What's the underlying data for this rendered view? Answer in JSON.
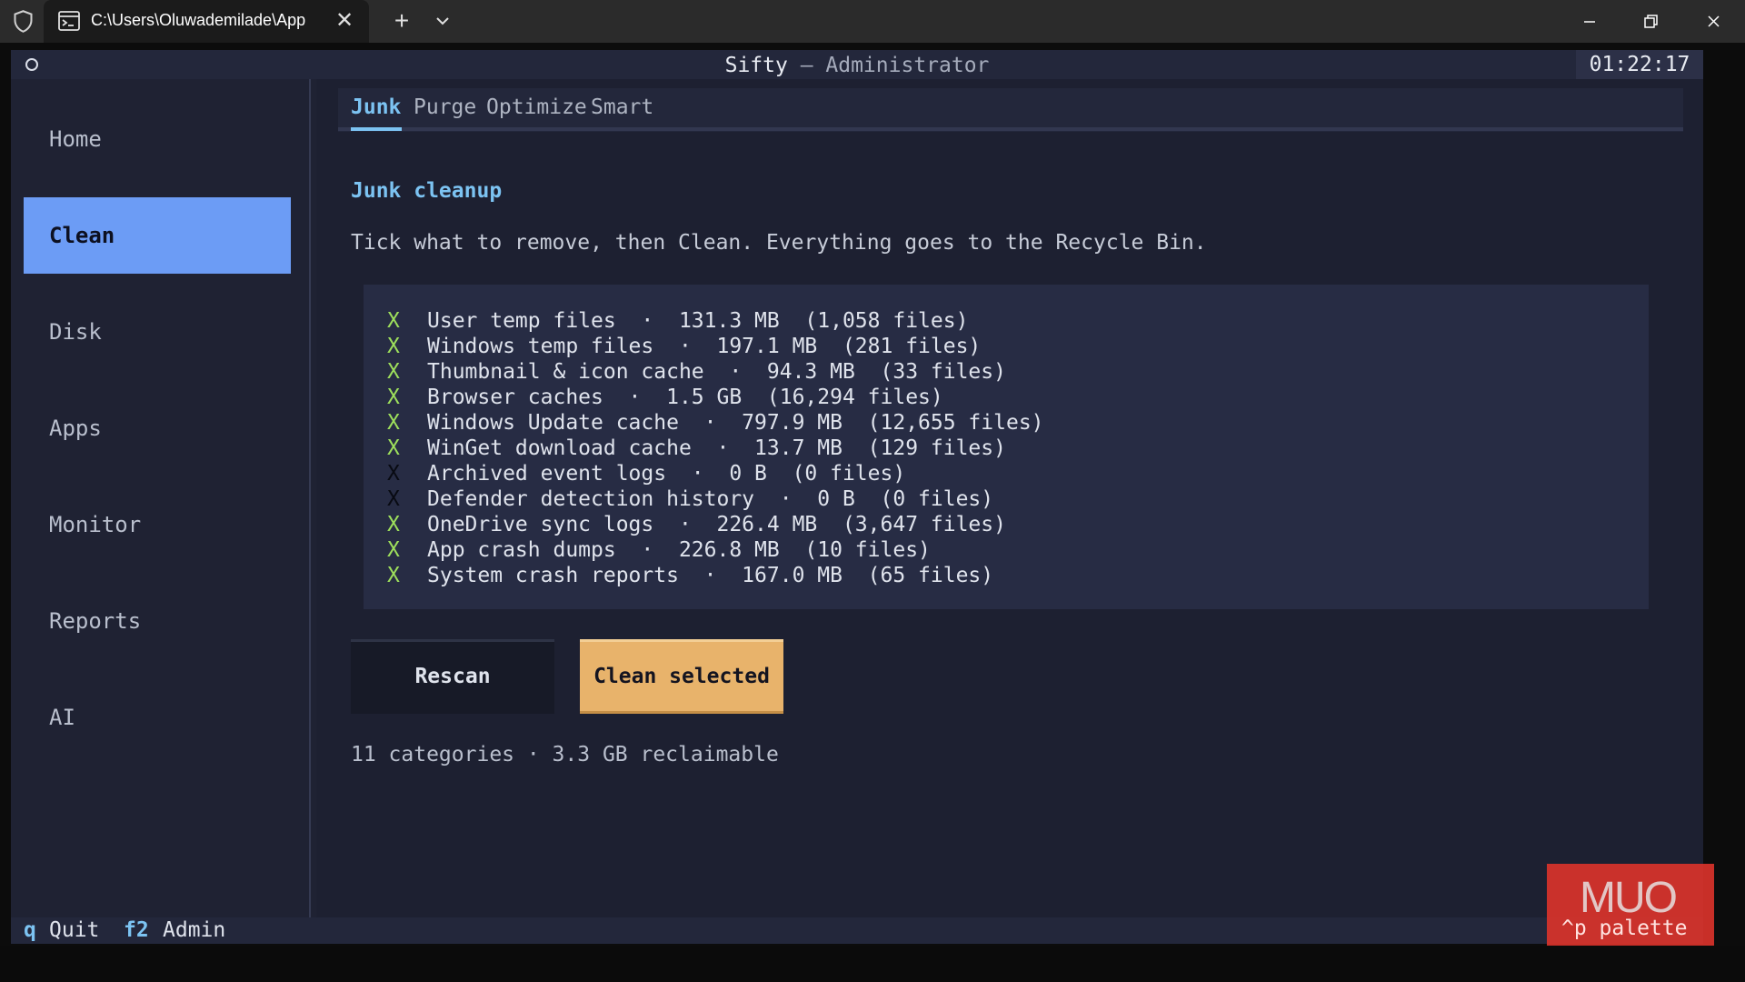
{
  "window": {
    "tab_title": "C:\\Users\\Oluwademilade\\App",
    "new_tab_glyph": "+",
    "close_glyph": "✕"
  },
  "app": {
    "name": "Sifty",
    "separator": " — ",
    "role": "Administrator",
    "clock": "01:22:17"
  },
  "sidebar": {
    "items": [
      {
        "label": "Home",
        "active": false
      },
      {
        "label": "Clean",
        "active": true
      },
      {
        "label": "Disk",
        "active": false
      },
      {
        "label": "Apps",
        "active": false
      },
      {
        "label": "Monitor",
        "active": false
      },
      {
        "label": "Reports",
        "active": false
      },
      {
        "label": "AI",
        "active": false
      }
    ]
  },
  "tabs": [
    {
      "label": "Junk",
      "active": true
    },
    {
      "label": "Purge",
      "active": false
    },
    {
      "label": "Optimize",
      "active": false
    },
    {
      "label": "Smart",
      "active": false
    }
  ],
  "junk": {
    "title": "Junk cleanup",
    "instructions": "Tick what to remove, then Clean. Everything goes to the Recycle Bin.",
    "mark_glyph": "X",
    "items": [
      {
        "label": "User temp files  ·  131.3 MB  (1,058 files)",
        "checked": true
      },
      {
        "label": "Windows temp files  ·  197.1 MB  (281 files)",
        "checked": true
      },
      {
        "label": "Thumbnail & icon cache  ·  94.3 MB  (33 files)",
        "checked": true
      },
      {
        "label": "Browser caches  ·  1.5 GB  (16,294 files)",
        "checked": true
      },
      {
        "label": "Windows Update cache  ·  797.9 MB  (12,655 files)",
        "checked": true
      },
      {
        "label": "WinGet download cache  ·  13.7 MB  (129 files)",
        "checked": true
      },
      {
        "label": "Archived event logs  ·  0 B  (0 files)",
        "checked": false
      },
      {
        "label": "Defender detection history  ·  0 B  (0 files)",
        "checked": false
      },
      {
        "label": "OneDrive sync logs  ·  226.4 MB  (3,647 files)",
        "checked": true
      },
      {
        "label": "App crash dumps  ·  226.8 MB  (10 files)",
        "checked": true
      },
      {
        "label": "System crash reports  ·  167.0 MB  (65 files)",
        "checked": true
      }
    ],
    "rescan_label": "Rescan",
    "clean_label": "Clean selected",
    "summary": "11 categories · 3.3 GB reclaimable"
  },
  "footer": {
    "quit_key": "q",
    "quit_label": "Quit",
    "admin_key": "f2",
    "admin_label": "Admin",
    "palette_hint": "^p palette"
  },
  "watermark": {
    "text": "MUO"
  },
  "colors": {
    "accent": "#7cc3f2",
    "active_nav": "#6c9cf5",
    "primary_button": "#e8b36b",
    "check_mark": "#9ee05c"
  }
}
